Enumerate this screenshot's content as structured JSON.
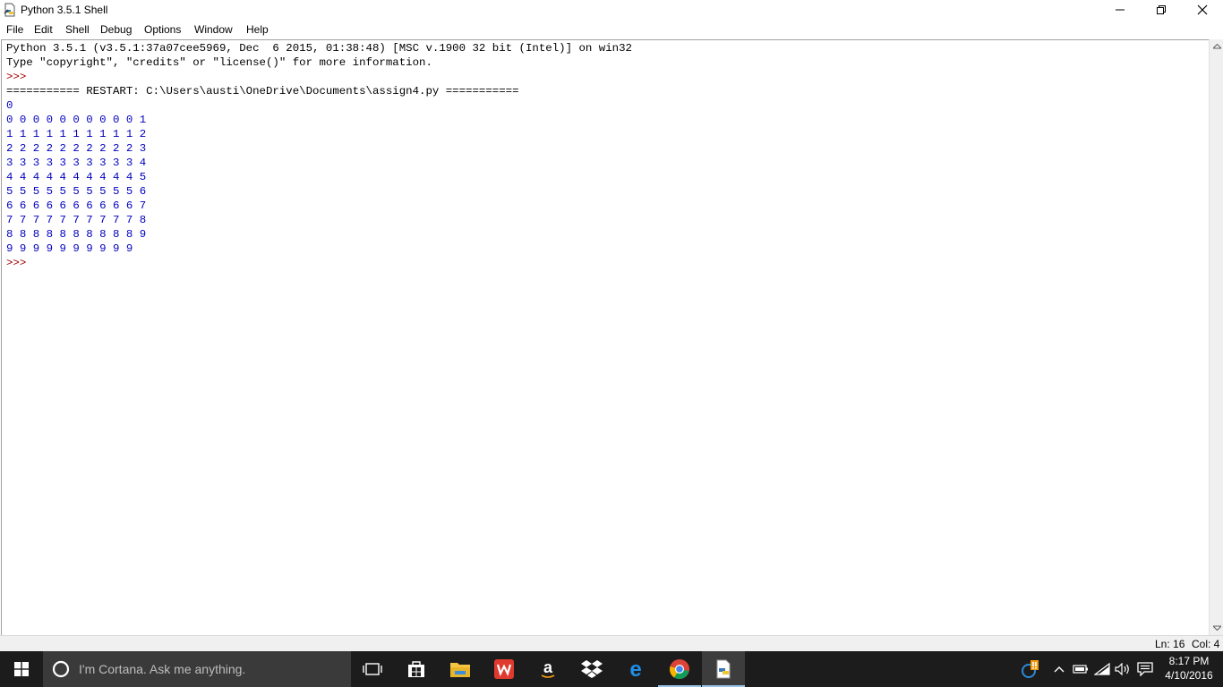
{
  "window": {
    "title": "Python 3.5.1 Shell"
  },
  "menu": {
    "items": [
      "File",
      "Edit",
      "Shell",
      "Debug",
      "Options",
      "Window",
      "Help"
    ]
  },
  "shell": {
    "header_line1": "Python 3.5.1 (v3.5.1:37a07cee5969, Dec  6 2015, 01:38:48) [MSC v.1900 32 bit (Intel)] on win32",
    "header_line2": "Type \"copyright\", \"credits\" or \"license()\" for more information.",
    "prompt1": ">>>",
    "restart_line": "=========== RESTART: C:\\Users\\austi\\OneDrive\\Documents\\assign4.py ===========",
    "output": [
      "0",
      "0 0 0 0 0 0 0 0 0 0 1",
      "1 1 1 1 1 1 1 1 1 1 2",
      "2 2 2 2 2 2 2 2 2 2 3",
      "3 3 3 3 3 3 3 3 3 3 4",
      "4 4 4 4 4 4 4 4 4 4 5",
      "5 5 5 5 5 5 5 5 5 5 6",
      "6 6 6 6 6 6 6 6 6 6 7",
      "7 7 7 7 7 7 7 7 7 7 8",
      "8 8 8 8 8 8 8 8 8 8 9",
      "9 9 9 9 9 9 9 9 9 9"
    ],
    "prompt2": ">>>"
  },
  "status": {
    "line": "Ln: 16",
    "col": "Col: 4"
  },
  "taskbar": {
    "cortana_placeholder": "I'm Cortana. Ask me anything.",
    "clock_time": "8:17 PM",
    "clock_date": "4/10/2016",
    "apps": [
      "task-view",
      "store",
      "file-explorer",
      "wps-office",
      "amazon",
      "dropbox",
      "edge",
      "chrome",
      "python-idle"
    ]
  },
  "colors": {
    "output_text": "#0000c0",
    "prompt": "#a00000",
    "taskbar_bg": "#1c1c1c"
  }
}
